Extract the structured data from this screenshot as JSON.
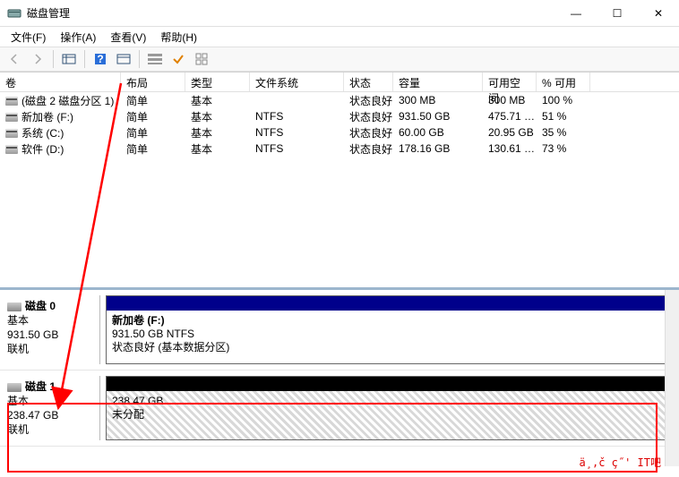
{
  "window": {
    "title": "磁盘管理",
    "min": "—",
    "max": "☐",
    "close": "✕"
  },
  "menu": {
    "file": "文件(F)",
    "action": "操作(A)",
    "view": "查看(V)",
    "help": "帮助(H)"
  },
  "columns": {
    "vol": "卷",
    "layout": "布局",
    "type": "类型",
    "fs": "文件系统",
    "status": "状态",
    "capacity": "容量",
    "free": "可用空间",
    "pct": "% 可用"
  },
  "rows": [
    {
      "vol": "(磁盘 2 磁盘分区 1)",
      "layout": "简单",
      "type": "基本",
      "fs": "",
      "status": "状态良好 (…",
      "capacity": "300 MB",
      "free": "300 MB",
      "pct": "100 %"
    },
    {
      "vol": "新加卷 (F:)",
      "layout": "简单",
      "type": "基本",
      "fs": "NTFS",
      "status": "状态良好 (…",
      "capacity": "931.50 GB",
      "free": "475.71 …",
      "pct": "51 %"
    },
    {
      "vol": "系统 (C:)",
      "layout": "简单",
      "type": "基本",
      "fs": "NTFS",
      "status": "状态良好 (…",
      "capacity": "60.00 GB",
      "free": "20.95 GB",
      "pct": "35 %"
    },
    {
      "vol": "软件 (D:)",
      "layout": "简单",
      "type": "基本",
      "fs": "NTFS",
      "status": "状态良好 (…",
      "capacity": "178.16 GB",
      "free": "130.61 …",
      "pct": "73 %"
    }
  ],
  "disk0": {
    "name": "磁盘 0",
    "type": "基本",
    "size": "931.50 GB",
    "state": "联机",
    "part": {
      "title": "新加卷  (F:)",
      "line2": "931.50 GB NTFS",
      "line3": "状态良好 (基本数据分区)"
    }
  },
  "disk1": {
    "name": "磁盘 1",
    "type": "基本",
    "size": "238.47 GB",
    "state": "联机",
    "part": {
      "line1": "238.47 GB",
      "line2": "未分配"
    }
  },
  "watermark": "ä¸‚č   ç˝'   IT吧"
}
